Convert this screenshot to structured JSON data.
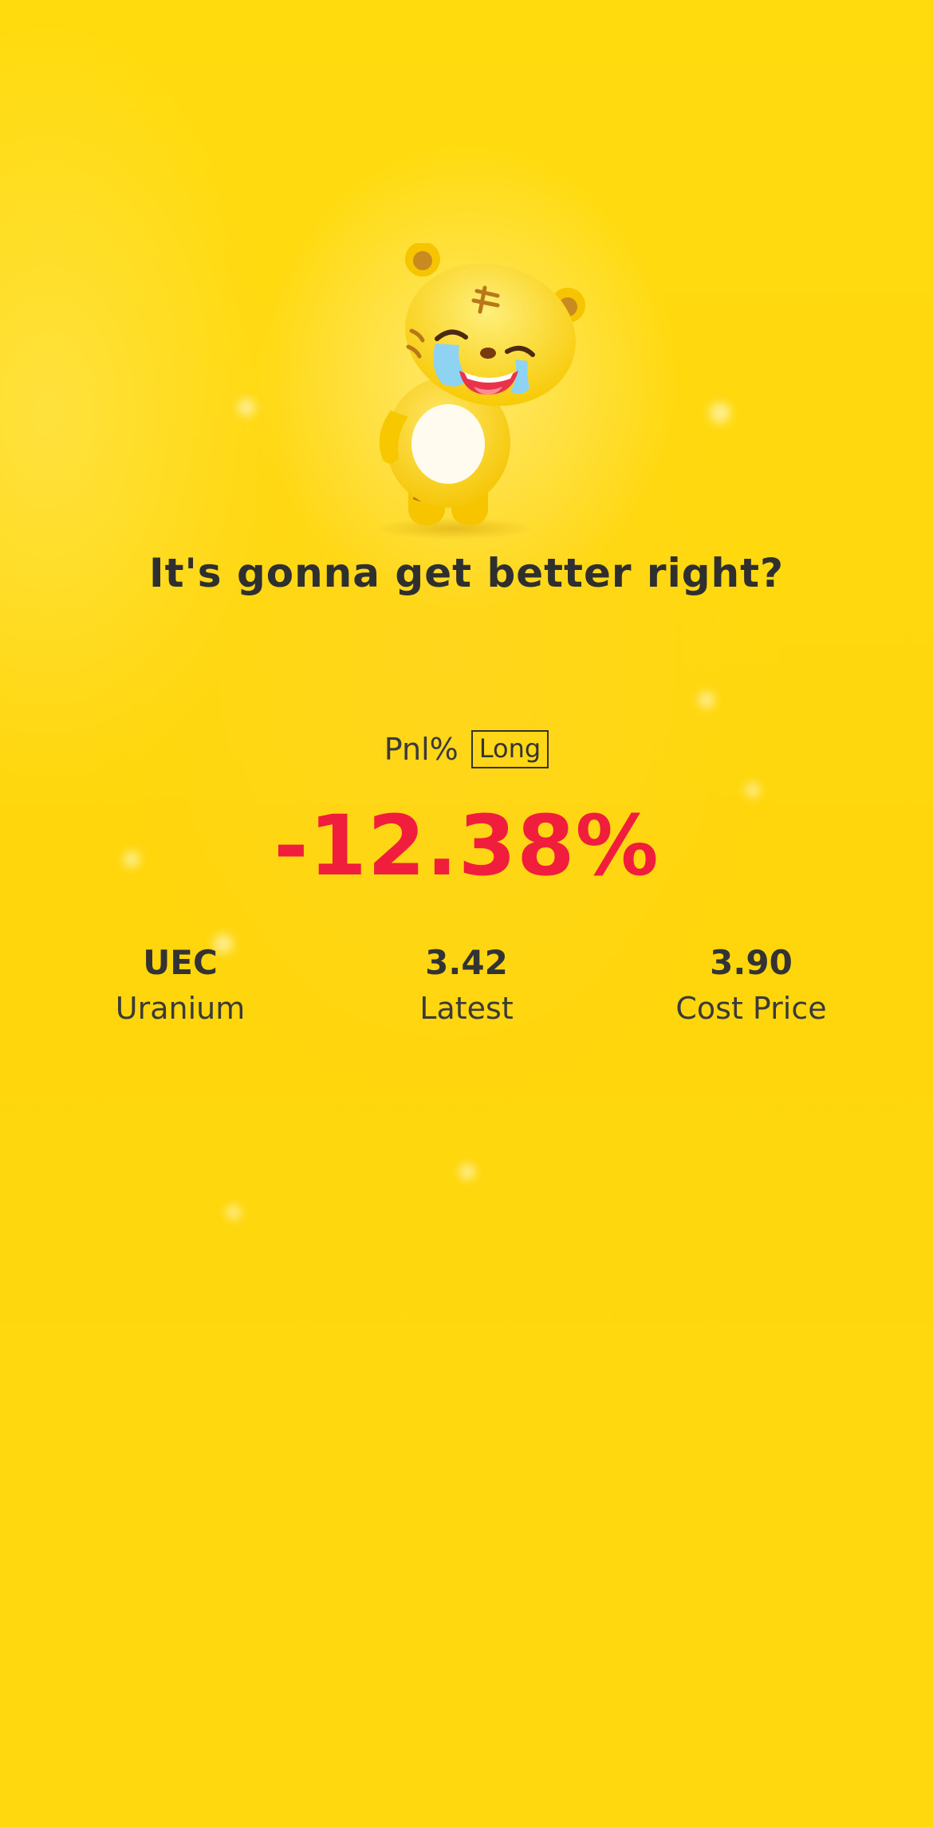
{
  "headline": "It's gonna get better right?",
  "pnl": {
    "label": "Pnl%",
    "direction": "Long",
    "value": "-12.38%"
  },
  "stats": [
    {
      "value": "UEC",
      "label": "Uranium"
    },
    {
      "value": "3.42",
      "label": "Latest"
    },
    {
      "value": "3.90",
      "label": "Cost Price"
    }
  ],
  "colors": {
    "background": "#FFD70A",
    "loss_red": "#F01E3C",
    "text_dark": "#333333"
  },
  "icons": {
    "mascot": "crying-laughing-tiger-mascot"
  }
}
